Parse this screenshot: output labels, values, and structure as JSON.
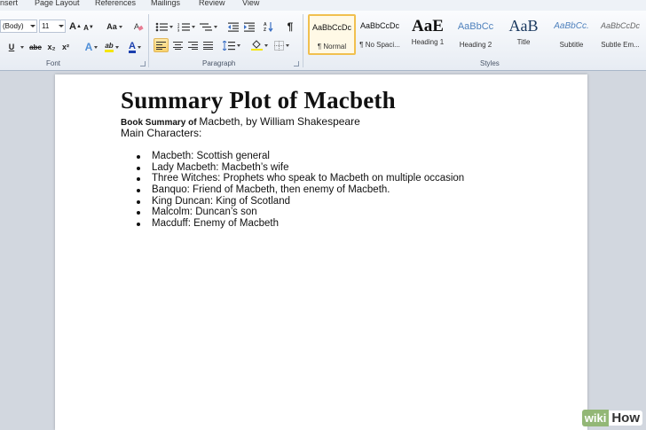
{
  "menu": {
    "tabs": [
      "nsert",
      "Page Layout",
      "References",
      "Mailings",
      "Review",
      "View"
    ]
  },
  "ribbon": {
    "font_group": {
      "label": "Font",
      "font_name": "(Body)",
      "font_size": "11",
      "grow_label": "A",
      "shrink_label": "A",
      "change_case_label": "Aa",
      "underline_label": "U",
      "strike_label": "abc",
      "subscript_label": "x₂",
      "superscript_label": "x²",
      "text_effects_label": "A",
      "font_color_label": "A",
      "highlight_label": "ab"
    },
    "paragraph_group": {
      "label": "Paragraph",
      "pilcrow_label": "¶"
    },
    "styles_group": {
      "label": "Styles",
      "items": [
        {
          "sample": "AaBbCcDc",
          "name": "¶ Normal"
        },
        {
          "sample": "AaBbCcDc",
          "name": "¶ No Spaci..."
        },
        {
          "sample": "AaE",
          "name": "Heading 1"
        },
        {
          "sample": "AaBbCc",
          "name": "Heading 2"
        },
        {
          "sample": "AaB",
          "name": "Title"
        },
        {
          "sample": "AaBbCc.",
          "name": "Subtitle"
        },
        {
          "sample": "AaBbCcDc",
          "name": "Subtle Em..."
        }
      ]
    }
  },
  "document": {
    "title": "Summary  Plot of Macbeth",
    "subtitle_bold": "Book Summary of ",
    "subtitle_rest": "Macbeth, by William Shakespeare",
    "characters_heading": "Main Characters:",
    "characters": [
      "Macbeth: Scottish general",
      "Lady Macbeth: Macbeth’s wife",
      "Three Witches: Prophets who speak to Macbeth on multiple occasion",
      "Banquo: Friend of Macbeth, then enemy of Macbeth.",
      "King Duncan: King of Scotland",
      "Malcolm: Duncan’s son",
      "Macduff: Enemy of Macbeth"
    ]
  },
  "watermark": {
    "wiki": "wiki",
    "how": "How"
  },
  "colors": {
    "ribbon_bg": "#e7ecf3",
    "selected_style": "#f1c04f",
    "text_effects": "#4f8fd8",
    "font_color": "#1a3fae",
    "highlight": "#f5e60b",
    "heading2_blue": "#4f81bd",
    "watermark_green": "#93b776"
  }
}
